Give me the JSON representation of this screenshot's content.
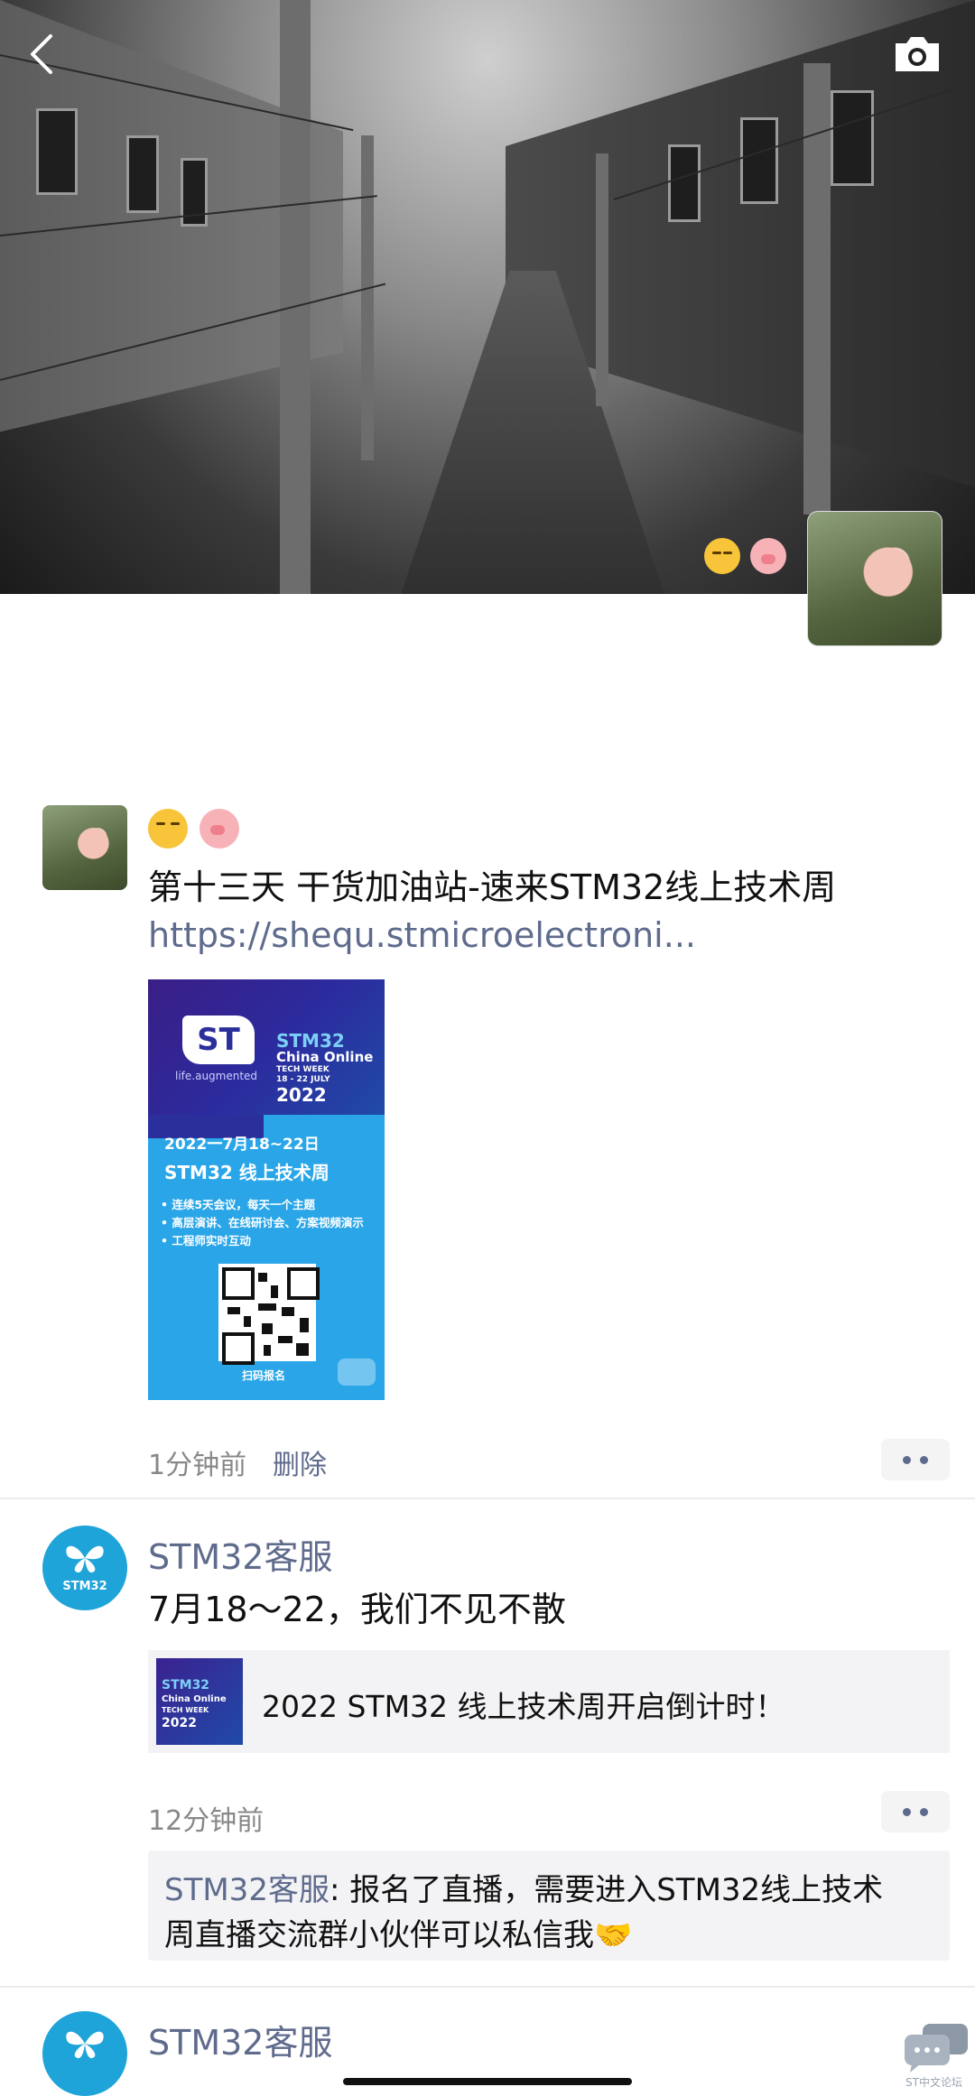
{
  "cover": {
    "reaction_emojis": [
      "sleepy-face",
      "pig-face"
    ]
  },
  "post": {
    "emojis": [
      "sleepy-face",
      "pig-face"
    ],
    "title": "第十三天  干货加油站-速来STM32线上技术周",
    "link": "https://shequ.stmicroelectroni...",
    "poster": {
      "logo": "ST",
      "tagline": "life.augmented",
      "stm": "STM32",
      "event": "China Online",
      "week": "TECH WEEK",
      "dates": "18 - 22 JULY",
      "year": "2022",
      "date_line": "2022一7月18~22日",
      "name_line": "STM32 线上技术周",
      "bullets": [
        "• 连续5天会议，每天一个主题",
        "• 高层演讲、在线研讨会、方案视频演示",
        "• 工程师实时互动"
      ],
      "scan_label": "扫码报名"
    },
    "time": "1分钟前",
    "delete_label": "删除"
  },
  "moment2": {
    "name": "STM32客服",
    "avatar_text": "STM32",
    "text": "7月18～22，我们不见不散",
    "share": {
      "thumb_stm": "STM32",
      "thumb_line1": "China Online",
      "thumb_line2": "TECH WEEK",
      "thumb_line3": "2022",
      "title": "2022 STM32 线上技术周开启倒计时！"
    },
    "time": "12分钟前",
    "comment": {
      "author": "STM32客服",
      "text_line1": ": 报名了直播，需要进入STM32线上技术",
      "text_line2": "周直播交流群小伙伴可以私信我🤝"
    }
  },
  "moment3": {
    "name": "STM32客服"
  },
  "watermark": {
    "text": "ST中文论坛"
  }
}
